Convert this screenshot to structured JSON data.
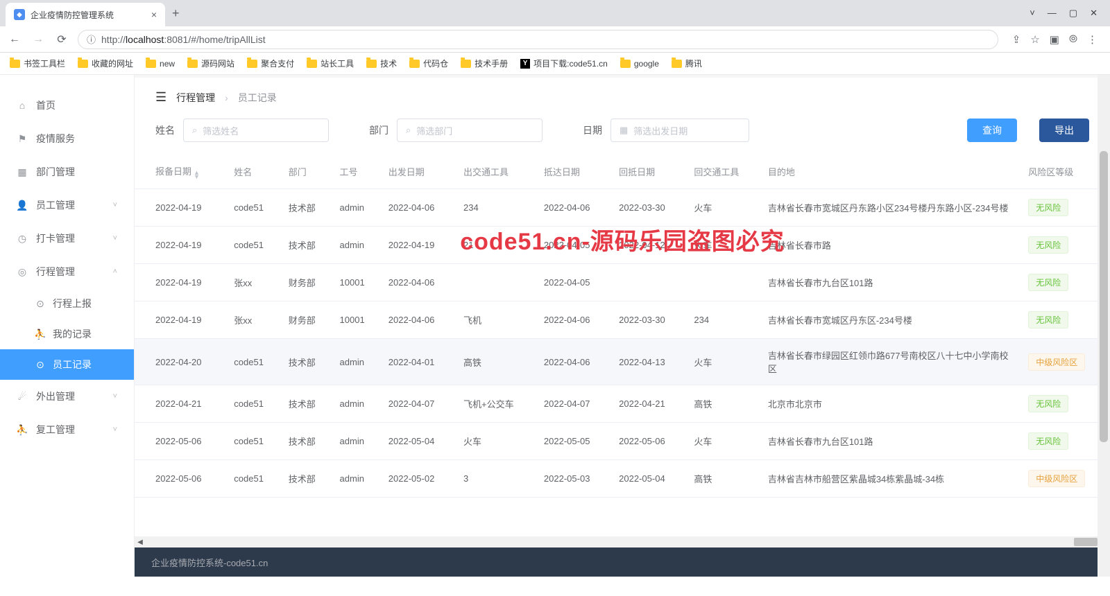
{
  "browser": {
    "tab_title": "企业疫情防控管理系统",
    "url_prefix": "http://",
    "url_host": "localhost",
    "url_port": ":8081",
    "url_path": "/#/home/tripAllList",
    "bookmarks": [
      "书签工具栏",
      "收藏的网址",
      "new",
      "源码网站",
      "聚合支付",
      "站长工具",
      "技术",
      "代码仓",
      "技术手册",
      "项目下载:code51.cn",
      "google",
      "腾讯"
    ]
  },
  "sidebar": {
    "items": [
      {
        "label": "首页",
        "icon": "home"
      },
      {
        "label": "疫情服务",
        "icon": "flag"
      },
      {
        "label": "部门管理",
        "icon": "grid"
      },
      {
        "label": "员工管理",
        "icon": "user",
        "sub": true,
        "open": false
      },
      {
        "label": "打卡管理",
        "icon": "clock",
        "sub": true,
        "open": false
      },
      {
        "label": "行程管理",
        "icon": "location",
        "sub": true,
        "open": true
      },
      {
        "label": "外出管理",
        "icon": "suitcase",
        "sub": true,
        "open": false
      },
      {
        "label": "复工管理",
        "icon": "person",
        "sub": true,
        "open": false
      }
    ],
    "trip_subs": [
      {
        "label": "行程上报",
        "icon": "loc"
      },
      {
        "label": "我的记录",
        "icon": "person"
      },
      {
        "label": "员工记录",
        "icon": "loc",
        "active": true
      }
    ]
  },
  "breadcrumb": {
    "a": "行程管理",
    "b": "员工记录"
  },
  "filters": {
    "name_label": "姓名",
    "name_ph": "筛选姓名",
    "dept_label": "部门",
    "dept_ph": "筛选部门",
    "date_label": "日期",
    "date_ph": "筛选出发日期",
    "query_btn": "查询",
    "export_btn": "导出"
  },
  "table": {
    "headers": [
      "报备日期",
      "姓名",
      "部门",
      "工号",
      "出发日期",
      "出交通工具",
      "抵达日期",
      "回抵日期",
      "回交通工具",
      "目的地",
      "风险区等级"
    ],
    "rows": [
      {
        "d": [
          "2022-04-19",
          "code51",
          "技术部",
          "admin",
          "2022-04-06",
          "234",
          "2022-04-06",
          "2022-03-30",
          "火车",
          "吉林省长春市宽城区丹东路小区234号楼丹东路小区-234号楼"
        ],
        "risk": "无风险",
        "rc": "green"
      },
      {
        "d": [
          "2022-04-19",
          "code51",
          "技术部",
          "admin",
          "2022-04-19",
          "21",
          "2022-04-05",
          "2022-04-12",
          "火车",
          "吉林省长春市路"
        ],
        "risk": "无风险",
        "rc": "green"
      },
      {
        "d": [
          "2022-04-19",
          "张xx",
          "财务部",
          "10001",
          "2022-04-06",
          "",
          "2022-04-05",
          "",
          "",
          "吉林省长春市九台区101路"
        ],
        "risk": "无风险",
        "rc": "green"
      },
      {
        "d": [
          "2022-04-19",
          "张xx",
          "财务部",
          "10001",
          "2022-04-06",
          "飞机",
          "2022-04-06",
          "2022-03-30",
          "234",
          "吉林省长春市宽城区丹东区-234号楼"
        ],
        "risk": "无风险",
        "rc": "green"
      },
      {
        "d": [
          "2022-04-20",
          "code51",
          "技术部",
          "admin",
          "2022-04-01",
          "高铁",
          "2022-04-06",
          "2022-04-13",
          "火车",
          "吉林省长春市绿园区红领巾路677号南校区八十七中小学南校区"
        ],
        "risk": "中级风险区",
        "rc": "orange",
        "hl": true
      },
      {
        "d": [
          "2022-04-21",
          "code51",
          "技术部",
          "admin",
          "2022-04-07",
          "飞机+公交车",
          "2022-04-07",
          "2022-04-21",
          "高铁",
          "北京市北京市"
        ],
        "risk": "无风险",
        "rc": "green"
      },
      {
        "d": [
          "2022-05-06",
          "code51",
          "技术部",
          "admin",
          "2022-05-04",
          "火车",
          "2022-05-05",
          "2022-05-06",
          "火车",
          "吉林省长春市九台区101路"
        ],
        "risk": "无风险",
        "rc": "green"
      },
      {
        "d": [
          "2022-05-06",
          "code51",
          "技术部",
          "admin",
          "2022-05-02",
          "3",
          "2022-05-03",
          "2022-05-04",
          "高铁",
          "吉林省吉林市船营区紫晶城34栋紫晶城-34栋"
        ],
        "risk": "中级风险区",
        "rc": "orange"
      }
    ]
  },
  "watermark": "code51.cn-源码乐园盗图必究",
  "footer": "企业疫情防控系统-code51.cn"
}
